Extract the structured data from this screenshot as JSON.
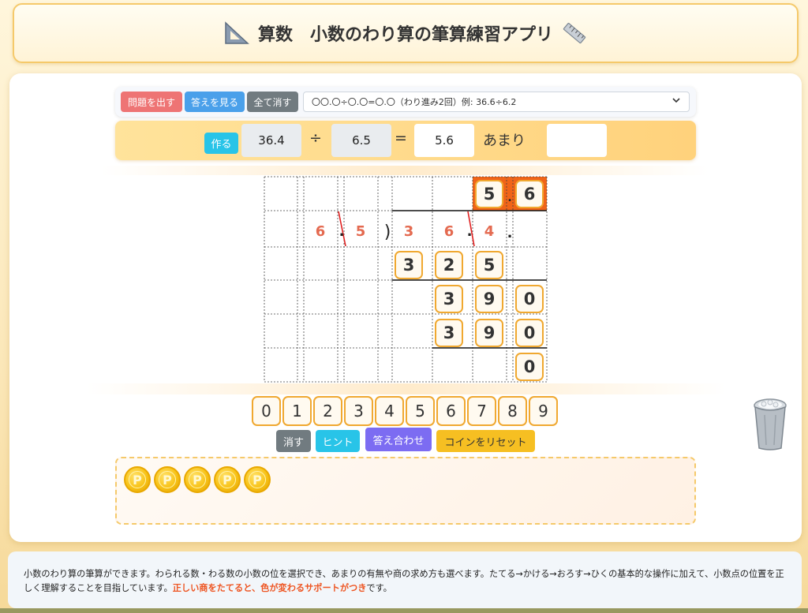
{
  "header": {
    "title": "算数　小数のわり算の筆算練習アプリ"
  },
  "toolbar": {
    "new_problem": "問題を出す",
    "show_answer": "答えを見る",
    "clear_all": "全て消す",
    "mode_selected": "〇〇.〇÷〇.〇=〇.〇（わり進み2回）例: 36.6÷6.2"
  },
  "problem": {
    "make_label": "作る",
    "dividend": "36.4",
    "divide_sign": "÷",
    "divisor": "6.5",
    "equals_sign": "=",
    "quotient": "5.6",
    "remainder_label": "あまり",
    "remainder": ""
  },
  "grid": {
    "quotient_digits": [
      "5",
      ".",
      "6"
    ],
    "divisor_digits": [
      "6",
      ".",
      "5"
    ],
    "bracket": ")",
    "dividend_digits": [
      "3",
      "6",
      ".",
      "4"
    ],
    "dividend_point_after": ".",
    "row1": [
      "3",
      "2",
      "5"
    ],
    "row2": [
      "3",
      "9",
      "0"
    ],
    "row3": [
      "3",
      "9",
      "0"
    ],
    "row4": [
      "0"
    ]
  },
  "keypad": {
    "digits": [
      "0",
      "1",
      "2",
      "3",
      "4",
      "5",
      "6",
      "7",
      "8",
      "9"
    ],
    "erase": "消す",
    "hint": "ヒント",
    "check": "答え合わせ",
    "reset_coins": "コインをリセット"
  },
  "coins": {
    "count": 5,
    "symbol": "P"
  },
  "footer": {
    "text_before": "小数のわり算の筆算ができます。わられる数・わる数の小数の位を選択でき、あまりの有無や商の求め方も選べます。たてる→かける→おろす→ひくの基本的な操作に加えて、小数点の位置を正しく理解することを目指しています。",
    "highlight": "正しい商をたてると、色が変わるサポートがつき",
    "text_after": "です。"
  },
  "colors": {
    "accent_red": "#ee7474",
    "accent_blue": "#4aa0ea",
    "tile_border": "#f0a830",
    "highlight_cell": "#f06418",
    "digit_red": "#e46a50"
  }
}
